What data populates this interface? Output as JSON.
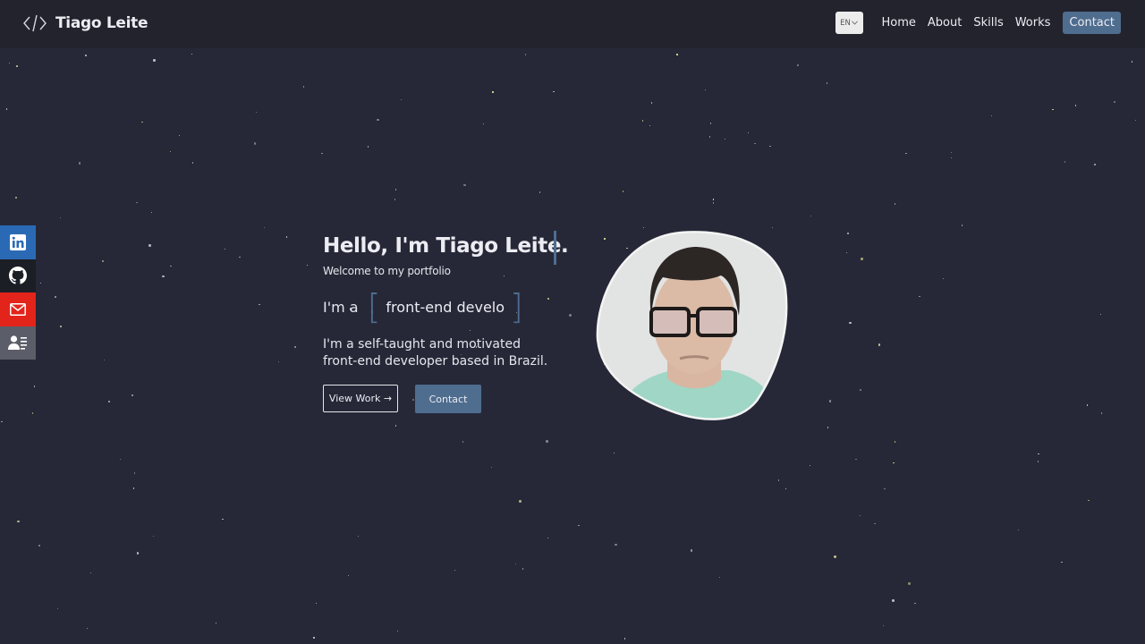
{
  "header": {
    "brand_icon": "code-brackets-icon",
    "brand_name": "Tiago Leite",
    "language": {
      "selected": "EN",
      "icon": "chevron-down-icon"
    },
    "nav": [
      {
        "label": "Home"
      },
      {
        "label": "About"
      },
      {
        "label": "Skills"
      },
      {
        "label": "Works"
      }
    ],
    "contact_label": "Contact"
  },
  "social": [
    {
      "name": "LinkedIn",
      "icon": "linkedin-icon",
      "color": "#2a6ab5"
    },
    {
      "name": "GitHub",
      "icon": "github-icon",
      "color": "#1c1e26"
    },
    {
      "name": "Email",
      "icon": "mail-icon",
      "color": "#e2241a"
    },
    {
      "name": "Resume",
      "icon": "contact-card-icon",
      "color": "#5b5d68"
    }
  ],
  "hero": {
    "title": "Hello, I'm Tiago Leite.",
    "subtitle": "Welcome to my portfolio",
    "role_prefix": "I'm a",
    "role_typed": "front-end develo",
    "bio_line1": "I'm a self-taught and motivated",
    "bio_line2": "front-end developer based in Brazil.",
    "view_work_label": "View Work →",
    "contact_label": "Contact"
  },
  "colors": {
    "background": "#262838",
    "header": "#23232e",
    "accent": "#4f6d8f",
    "text": "#ececf2"
  }
}
